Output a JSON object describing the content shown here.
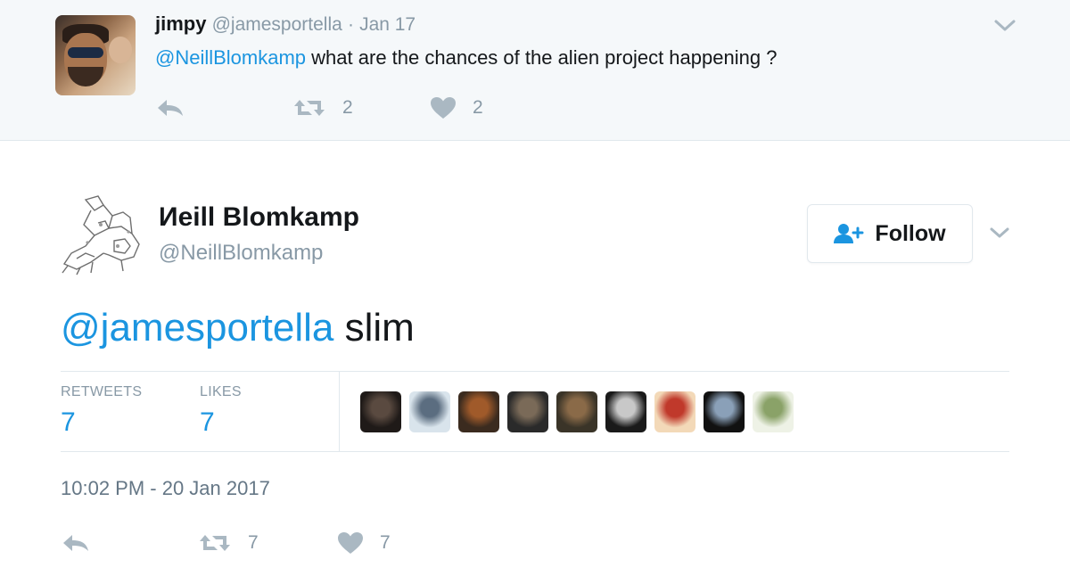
{
  "parent_tweet": {
    "name": "jimpy",
    "handle": "@jamesportella",
    "separator": "·",
    "date": "Jan 17",
    "mention": "@NeillBlomkamp",
    "text": "what are the chances of the alien project happening ?",
    "actions": {
      "retweets": "2",
      "likes": "2"
    },
    "icons": [
      "reply-icon",
      "retweet-icon",
      "like-icon",
      "chevron-down-icon"
    ]
  },
  "main_tweet": {
    "name": "Иeill Blomkamp",
    "handle": "@NeillBlomkamp",
    "follow_label": "Follow",
    "mention": "@jamesportella",
    "text": "slim",
    "stats": {
      "retweets_label": "RETWEETS",
      "retweets_value": "7",
      "likes_label": "LIKES",
      "likes_value": "7"
    },
    "likers": [
      {
        "name": "liker-avatar-1",
        "colors": [
          "#1f1a18",
          "#5a4a40"
        ]
      },
      {
        "name": "liker-avatar-2",
        "colors": [
          "#d9e4ec",
          "#5b6d80"
        ]
      },
      {
        "name": "liker-avatar-3",
        "colors": [
          "#3b2b1f",
          "#a05a2a"
        ]
      },
      {
        "name": "liker-avatar-4",
        "colors": [
          "#2a2a2a",
          "#7a6a58"
        ]
      },
      {
        "name": "liker-avatar-5",
        "colors": [
          "#3a3428",
          "#8a6a48"
        ]
      },
      {
        "name": "liker-avatar-6",
        "colors": [
          "#1a1a1a",
          "#c8c8c8"
        ]
      },
      {
        "name": "liker-avatar-7",
        "colors": [
          "#f3d9b8",
          "#c0392b"
        ]
      },
      {
        "name": "liker-avatar-8",
        "colors": [
          "#111111",
          "#8aa0b8"
        ]
      },
      {
        "name": "liker-avatar-9",
        "colors": [
          "#eef2e6",
          "#8aa268"
        ]
      }
    ],
    "timestamp": "10:02 PM - 20 Jan 2017",
    "actions": {
      "retweets": "7",
      "likes": "7"
    },
    "icons": [
      "reply-icon",
      "retweet-icon",
      "like-icon",
      "chevron-down-icon",
      "follow-user-icon"
    ]
  },
  "colors": {
    "accent": "#1b95e0",
    "muted": "#8899a6",
    "icon": "#aab8c2",
    "parent_bg": "#f5f8fa",
    "border": "#e1e8ed"
  }
}
